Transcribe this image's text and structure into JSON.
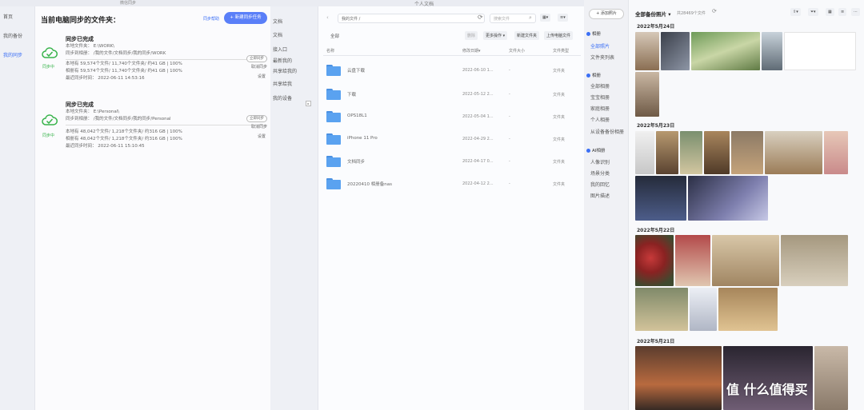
{
  "sync_window": {
    "title": "当前电脑同步的文件夹：",
    "title_bar": "微信同步",
    "sidebar": [
      "首页",
      "我的备份",
      "我的同步"
    ],
    "link": "同步帮助",
    "new_task_button": "+ 新建同步任务",
    "tasks": [
      {
        "status": "同步已完成",
        "local_folder": "本地文件夹：  E:\\WORK\\",
        "target": "同步到相册：  /我的文件/文档同步/我的同步/WORK",
        "local_stats": "本地有 59,574个文件/ 11,740个文件夹/ 约41 GB | 100%",
        "nas_stats": "相册有 59,574个文件/ 11,740个文件夹/ 约41 GB | 100%",
        "last_time": "最近同步时间：  2022-06-11 14:53:16",
        "badge": "同步中",
        "pill": "立即同步",
        "cancel": "取消同步",
        "settings": "设置"
      },
      {
        "status": "同步已完成",
        "local_folder": "本地文件夹：  E:\\Personal\\",
        "target": "同步到相册：  /我的文件/文档同步/我的同步/Personal",
        "local_stats": "本地有 48,042个文件/ 1,218个文件夹/ 约316 GB | 100%",
        "nas_stats": "相册有 48,042个文件/ 1,218个文件夹/ 约316 GB | 100%",
        "last_time": "最近同步时间：  2022-06-11 15:10:45",
        "badge": "同步中",
        "pill": "立即同步",
        "cancel": "取消同步",
        "settings": "设置"
      }
    ]
  },
  "files_window": {
    "title": "个人文档",
    "sidebar": [
      "文档",
      "文档",
      "接入口",
      "最新我的",
      "共享给我的",
      "共享给我",
      "我的设备"
    ],
    "path": "我的文件 /",
    "search_placeholder": "搜索文件",
    "breadcrumb": "全部",
    "toolbar": [
      "删除",
      "更多操作 ▾",
      "新建文件夹",
      "上传电脑文件"
    ],
    "columns": [
      "名称",
      "修改日期▾",
      "文件大小",
      "文件类型"
    ],
    "rows": [
      {
        "name": "云盘下载",
        "date": "2022-06-10 1...",
        "size": "-",
        "type": "文件夹"
      },
      {
        "name": "下载",
        "date": "2022-05-12 2...",
        "size": "-",
        "type": "文件夹"
      },
      {
        "name": "OPS18L1",
        "date": "2022-05-04 1...",
        "size": "-",
        "type": "文件夹"
      },
      {
        "name": "iPhone 11 Pro",
        "date": "2022-04-29 2...",
        "size": "-",
        "type": "文件夹"
      },
      {
        "name": "文档同步",
        "date": "2022-04-17 0...",
        "size": "-",
        "type": "文件夹"
      },
      {
        "name": "20220410 相册备nas",
        "date": "2022-04-12 2...",
        "size": "-",
        "type": "文件夹"
      }
    ]
  },
  "photos_window": {
    "add_button": "+ 添加照片",
    "title": "全部备份照片 ▾",
    "count": "共28469个文件",
    "sections": [
      {
        "header": "相册",
        "items": [
          "全部照片",
          "文件夹列表"
        ]
      },
      {
        "header": "相册",
        "items": [
          "全部相册",
          "宝宝相册",
          "家庭相册",
          "个人相册",
          "从设备备份相册"
        ]
      },
      {
        "header": "AI相册",
        "items": [
          "人像识别",
          "场景分类",
          "我的回忆",
          "图片描述"
        ]
      }
    ],
    "dates": [
      "2022年5月24日",
      "2022年5月23日",
      "2022年5月22日",
      "2022年5月21日"
    ]
  },
  "watermark": "值 什么值得买",
  "colors": {
    "accent": "#3b6ff5",
    "success": "#37b34a",
    "folder": "#5aa2f0"
  }
}
